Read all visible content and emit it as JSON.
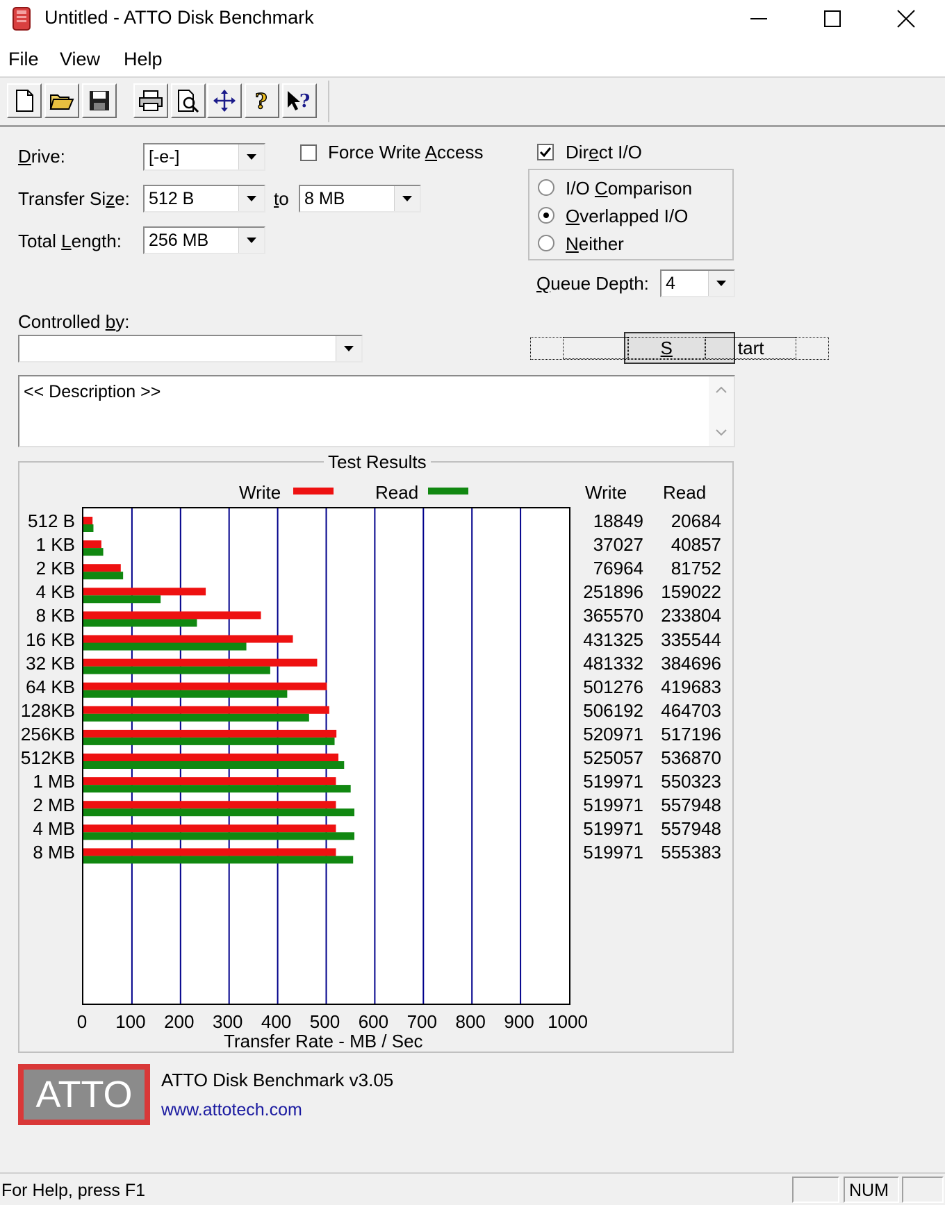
{
  "window": {
    "title": "Untitled - ATTO Disk Benchmark"
  },
  "menu": [
    "File",
    "View",
    "Help"
  ],
  "toolbar": [
    "new-icon",
    "open-icon",
    "save-icon",
    "print-icon",
    "print-preview-icon",
    "move-icon",
    "help-icon",
    "context-help-icon"
  ],
  "form": {
    "drive_label_pre": "",
    "drive_label_u": "D",
    "drive_label_post": "rive:",
    "drive_value": "[-e-]",
    "force_write_pre": "Force Write ",
    "force_write_u": "A",
    "force_write_post": "ccess",
    "force_write_checked": false,
    "direct_io_pre": "Dir",
    "direct_io_u": "e",
    "direct_io_post": "ct I/O",
    "direct_io_checked": true,
    "transfer_label_pre": "Transfer Si",
    "transfer_label_u": "z",
    "transfer_label_post": "e:",
    "transfer_from": "512 B",
    "to_pre": "",
    "to_u": "t",
    "to_post": "o",
    "transfer_to": "8 MB",
    "total_label_pre": "Total ",
    "total_label_u": "L",
    "total_label_post": "ength:",
    "total_value": "256 MB",
    "io_comparison_pre": "I/O ",
    "io_comparison_u": "C",
    "io_comparison_post": "omparison",
    "overlapped_pre": "",
    "overlapped_u": "O",
    "overlapped_post": "verlapped I/O",
    "neither_pre": "",
    "neither_u": "N",
    "neither_post": "either",
    "selected_mode": "Overlapped I/O",
    "queue_label_pre": "",
    "queue_label_u": "Q",
    "queue_label_post": "ueue Depth:",
    "queue_value": "4",
    "controlled_label_pre": "Controlled ",
    "controlled_label_u": "b",
    "controlled_label_post": "y:",
    "controlled_value": "",
    "start_label_pre": "",
    "start_label_u": "S",
    "start_label_post": "tart",
    "description": "<< Description >>"
  },
  "results": {
    "group_title": "Test Results",
    "col_write": "Write",
    "col_read": "Read",
    "write_color": "#ee1111",
    "read_color": "#118811",
    "grid_color": "#00008b"
  },
  "chart_data": {
    "type": "bar",
    "orientation": "horizontal",
    "categories": [
      "512 B",
      "1 KB",
      "2 KB",
      "4 KB",
      "8 KB",
      "16 KB",
      "32 KB",
      "64 KB",
      "128KB",
      "256KB",
      "512KB",
      "1 MB",
      "2 MB",
      "4 MB",
      "8 MB"
    ],
    "series": [
      {
        "name": "Write",
        "values": [
          18849,
          37027,
          76964,
          251896,
          365570,
          431325,
          481332,
          501276,
          506192,
          520971,
          525057,
          519971,
          519971,
          519971,
          519971
        ]
      },
      {
        "name": "Read",
        "values": [
          20684,
          40857,
          81752,
          159022,
          233804,
          335544,
          384696,
          419683,
          464703,
          517196,
          536870,
          550323,
          557948,
          557948,
          555383
        ]
      }
    ],
    "xlabel": "Transfer Rate - MB / Sec",
    "xlim": [
      0,
      1000
    ],
    "xticks": [
      "0",
      "100",
      "200",
      "300",
      "400",
      "500",
      "600",
      "700",
      "800",
      "900",
      "1000"
    ],
    "value_unit_divisor": 1000,
    "legend": "top",
    "grid": true
  },
  "footer": {
    "logo_text": "ATTO",
    "version": "ATTO Disk Benchmark v3.05",
    "url": "www.attotech.com"
  },
  "status": {
    "help": "For Help, press F1",
    "num": "NUM"
  }
}
